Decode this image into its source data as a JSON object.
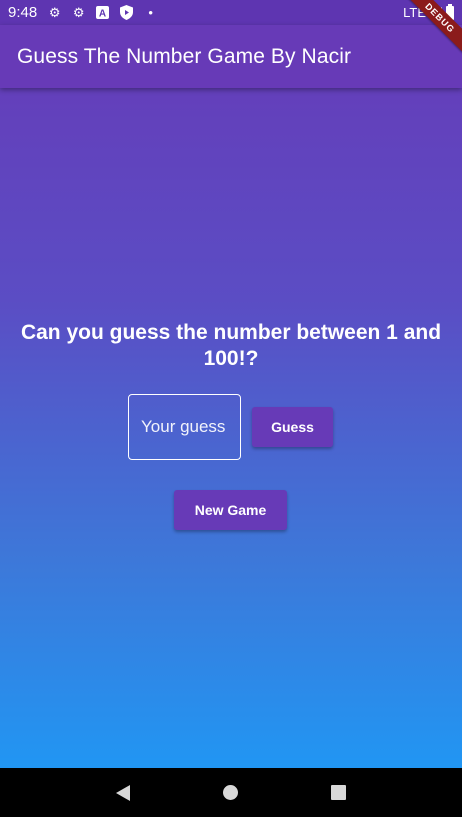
{
  "status_bar": {
    "time": "9:48",
    "network": "LTE",
    "icons": [
      "gear-icon",
      "gear-icon",
      "app-a-icon",
      "shield-icon",
      "dot-icon"
    ]
  },
  "app_bar": {
    "title": "Guess The Number Game By Nacir"
  },
  "debug_banner": "DEBUG",
  "main": {
    "prompt": "Can you guess the number between 1 and 100!?",
    "input_placeholder": "Your guess",
    "guess_button": "Guess",
    "new_game_button": "New Game"
  },
  "colors": {
    "primary": "#673ab7",
    "status_bar": "#5e35b1",
    "gradient_top": "#673ab7",
    "gradient_bottom": "#2196f3",
    "debug_banner": "#8b1b1b"
  }
}
